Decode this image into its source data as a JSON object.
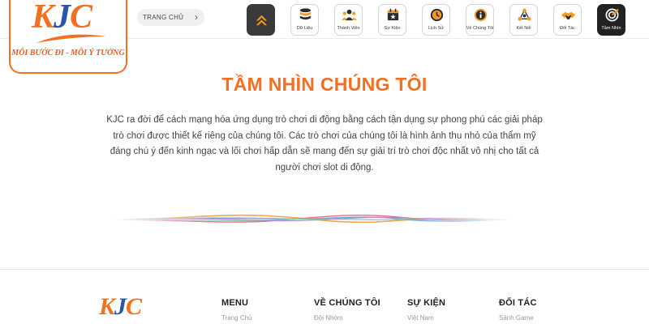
{
  "brand": {
    "logo_text": "KJC",
    "tagline": "MỖI BƯỚC ĐI - MỖI Ý TƯỞNG",
    "colors": {
      "orange": "#f36f21",
      "blue": "#2a56a8",
      "dark": "#222222"
    }
  },
  "breadcrumb": {
    "label": "TRANG CHỦ",
    "icon": "chevron-right-icon"
  },
  "nav": {
    "items": [
      {
        "label": "",
        "icon": "chevron-up-icon"
      },
      {
        "label": "Dữ Liệu",
        "icon": "database-icon"
      },
      {
        "label": "Thành Viên",
        "icon": "users-icon"
      },
      {
        "label": "Sự Kiện",
        "icon": "calendar-icon"
      },
      {
        "label": "Lịch Sử",
        "icon": "clock-icon"
      },
      {
        "label": "Về Chúng Tôi",
        "icon": "info-icon"
      },
      {
        "label": "Kết Nối",
        "icon": "network-icon"
      },
      {
        "label": "Đối Tác",
        "icon": "handshake-icon"
      },
      {
        "label": "Tầm Nhìn",
        "icon": "target-icon"
      }
    ],
    "active_index": 8
  },
  "main": {
    "title": "TẦM NHÌN CHÚNG TÔI",
    "body": "KJC ra đời để cách mạng hóa ứng dụng trò chơi di động bằng cách tận dụng sự phong phú các giải pháp trò chơi được thiết kế riêng của chúng tôi. Các trò chơi của chúng tôi là hình ảnh thu nhỏ của thẩm mỹ đáng chú ý đến kinh ngạc và lối chơi hấp dẫn sẽ mang đến sự giải trí trò chơi độc nhất vô nhị cho tất cả người chơi slot di động."
  },
  "footer": {
    "logo_text": "KJC",
    "columns": [
      {
        "heading": "MENU",
        "first_item": "Trang Chủ"
      },
      {
        "heading": "VỀ CHÚNG TÔI",
        "first_item": "Đội Nhóm"
      },
      {
        "heading": "SỰ KIỆN",
        "first_item": "Việt Nam"
      },
      {
        "heading": "ĐỐI TÁC",
        "first_item": "Sảnh Game"
      }
    ]
  }
}
